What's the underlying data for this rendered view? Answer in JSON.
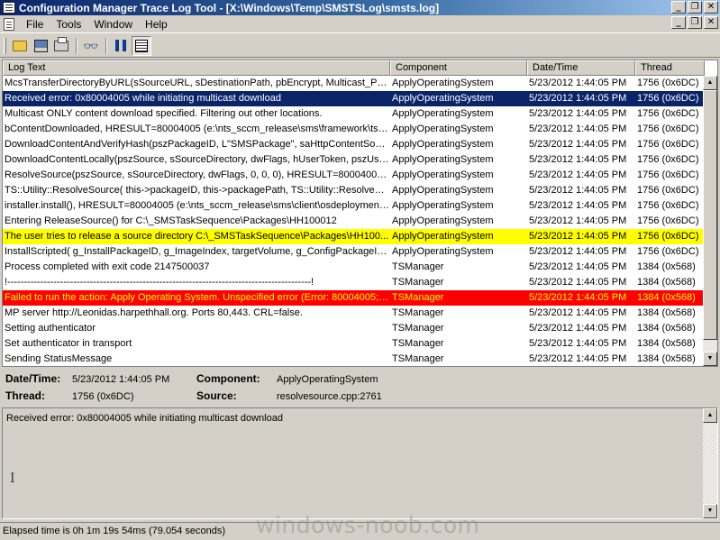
{
  "window": {
    "title": "Configuration Manager Trace Log Tool - [X:\\Windows\\Temp\\SMSTSLog\\smsts.log]",
    "minimize": "_",
    "restore": "❐",
    "close": "✕"
  },
  "menu": {
    "file": "File",
    "tools": "Tools",
    "window": "Window",
    "help": "Help"
  },
  "toolbar": {
    "icons": [
      "open-icon",
      "computer-icon",
      "print-icon",
      "find-icon",
      "pause-icon",
      "list-view-icon"
    ],
    "binoculars": "👓"
  },
  "columns": {
    "log_text": "Log Text",
    "component": "Component",
    "datetime": "Date/Time",
    "thread": "Thread"
  },
  "rows": [
    {
      "text": "McsTransferDirectoryByURL(sSourceURL, sDestinationPath, pbEncrypt, Multicast_Prog...",
      "component": "ApplyOperatingSystem",
      "datetime": "5/23/2012 1:44:05 PM",
      "thread": "1756 (0x6DC)",
      "state": "normal"
    },
    {
      "text": "Received error: 0x80004005 while initiating multicast download",
      "component": "ApplyOperatingSystem",
      "datetime": "5/23/2012 1:44:05 PM",
      "thread": "1756 (0x6DC)",
      "state": "selected"
    },
    {
      "text": "Multicast ONLY content download specified. Filtering out other locations.",
      "component": "ApplyOperatingSystem",
      "datetime": "5/23/2012 1:44:05 PM",
      "thread": "1756 (0x6DC)",
      "state": "normal"
    },
    {
      "text": "bContentDownloaded, HRESULT=80004005 (e:\\nts_sccm_release\\sms\\framework\\tsc...",
      "component": "ApplyOperatingSystem",
      "datetime": "5/23/2012 1:44:05 PM",
      "thread": "1756 (0x6DC)",
      "state": "normal"
    },
    {
      "text": "DownloadContentAndVerifyHash(pszPackageID, L\"SMSPackage\", saHttpContentSour...",
      "component": "ApplyOperatingSystem",
      "datetime": "5/23/2012 1:44:05 PM",
      "thread": "1756 (0x6DC)",
      "state": "normal"
    },
    {
      "text": "DownloadContentLocally(pszSource, sSourceDirectory, dwFlags, hUserToken, pszUser...",
      "component": "ApplyOperatingSystem",
      "datetime": "5/23/2012 1:44:05 PM",
      "thread": "1756 (0x6DC)",
      "state": "normal"
    },
    {
      "text": "ResolveSource(pszSource, sSourceDirectory, dwFlags, 0, 0, 0), HRESULT=80004005 (...",
      "component": "ApplyOperatingSystem",
      "datetime": "5/23/2012 1:44:05 PM",
      "thread": "1756 (0x6DC)",
      "state": "normal"
    },
    {
      "text": "TS::Utility::ResolveSource( this->packageID, this->packagePath, TS::Utility::ResolveSo...",
      "component": "ApplyOperatingSystem",
      "datetime": "5/23/2012 1:44:05 PM",
      "thread": "1756 (0x6DC)",
      "state": "normal"
    },
    {
      "text": "installer.install(), HRESULT=80004005 (e:\\nts_sccm_release\\sms\\client\\osdeployment\\...",
      "component": "ApplyOperatingSystem",
      "datetime": "5/23/2012 1:44:05 PM",
      "thread": "1756 (0x6DC)",
      "state": "normal"
    },
    {
      "text": "Entering ReleaseSource() for C:\\_SMSTaskSequence\\Packages\\HH100012",
      "component": "ApplyOperatingSystem",
      "datetime": "5/23/2012 1:44:05 PM",
      "thread": "1756 (0x6DC)",
      "state": "normal"
    },
    {
      "text": "The user tries to release a source directory C:\\_SMSTaskSequence\\Packages\\HH100...",
      "component": "ApplyOperatingSystem",
      "datetime": "5/23/2012 1:44:05 PM",
      "thread": "1756 (0x6DC)",
      "state": "warning"
    },
    {
      "text": "InstallScripted( g_InstallPackageID, g_ImageIndex, targetVolume, g_ConfigPackageID, ...",
      "component": "ApplyOperatingSystem",
      "datetime": "5/23/2012 1:44:05 PM",
      "thread": "1756 (0x6DC)",
      "state": "normal"
    },
    {
      "text": "Process completed with exit code 2147500037",
      "component": "TSManager",
      "datetime": "5/23/2012 1:44:05 PM",
      "thread": "1384 (0x568)",
      "state": "normal"
    },
    {
      "text": "!--------------------------------------------------------------------------------------------!",
      "component": "TSManager",
      "datetime": "5/23/2012 1:44:05 PM",
      "thread": "1384 (0x568)",
      "state": "normal"
    },
    {
      "text": "Failed to run the action: Apply Operating System. Unspecified error (Error: 80004005; So...",
      "component": "TSManager",
      "datetime": "5/23/2012 1:44:05 PM",
      "thread": "1384 (0x568)",
      "state": "error"
    },
    {
      "text": "MP server http://Leonidas.harpethhall.org. Ports 80,443. CRL=false.",
      "component": "TSManager",
      "datetime": "5/23/2012 1:44:05 PM",
      "thread": "1384 (0x568)",
      "state": "normal"
    },
    {
      "text": "Setting authenticator",
      "component": "TSManager",
      "datetime": "5/23/2012 1:44:05 PM",
      "thread": "1384 (0x568)",
      "state": "normal"
    },
    {
      "text": "Set authenticator in transport",
      "component": "TSManager",
      "datetime": "5/23/2012 1:44:05 PM",
      "thread": "1384 (0x568)",
      "state": "normal"
    },
    {
      "text": "Sending StatusMessage",
      "component": "TSManager",
      "datetime": "5/23/2012 1:44:05 PM",
      "thread": "1384 (0x568)",
      "state": "normal"
    }
  ],
  "detail": {
    "datetime_label": "Date/Time:",
    "datetime_value": "5/23/2012 1:44:05 PM",
    "component_label": "Component:",
    "component_value": "ApplyOperatingSystem",
    "thread_label": "Thread:",
    "thread_value": "1756 (0x6DC)",
    "source_label": "Source:",
    "source_value": "resolvesource.cpp:2761"
  },
  "message": "Received error: 0x80004005 while initiating multicast download",
  "caret": "I",
  "scroll": {
    "up": "▲",
    "down": "▼"
  },
  "status": "Elapsed time is 0h 1m 19s 54ms (79.054 seconds)",
  "watermark": "windows-noob.com"
}
